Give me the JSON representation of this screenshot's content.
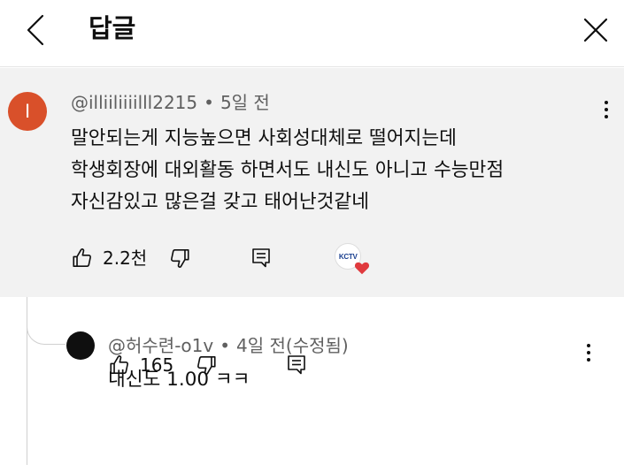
{
  "header": {
    "title": "답글",
    "back_icon": "chevron-left-icon",
    "close_icon": "close-icon"
  },
  "parent_comment": {
    "avatar_letter": "I",
    "avatar_color": "#d9502a",
    "author": "@illiiliiiilll2215",
    "time": "5일 전",
    "lines": [
      "말안되는게 지능높으면 사회성대체로 떨어지는데",
      "학생회장에 대외활동 하면서도 내신도 아니고 수능만점",
      "자신감있고 많은걸 갖고 태어난것같네"
    ],
    "like_count": "2.2천",
    "creator_logo": "KCTV",
    "heart_color": "#e03a3e"
  },
  "reply_comment": {
    "author": "@허수련-o1v",
    "time": "4일 전(수정됨)",
    "text": "내신도 1.00 ㅋㅋ",
    "like_count": "165"
  }
}
